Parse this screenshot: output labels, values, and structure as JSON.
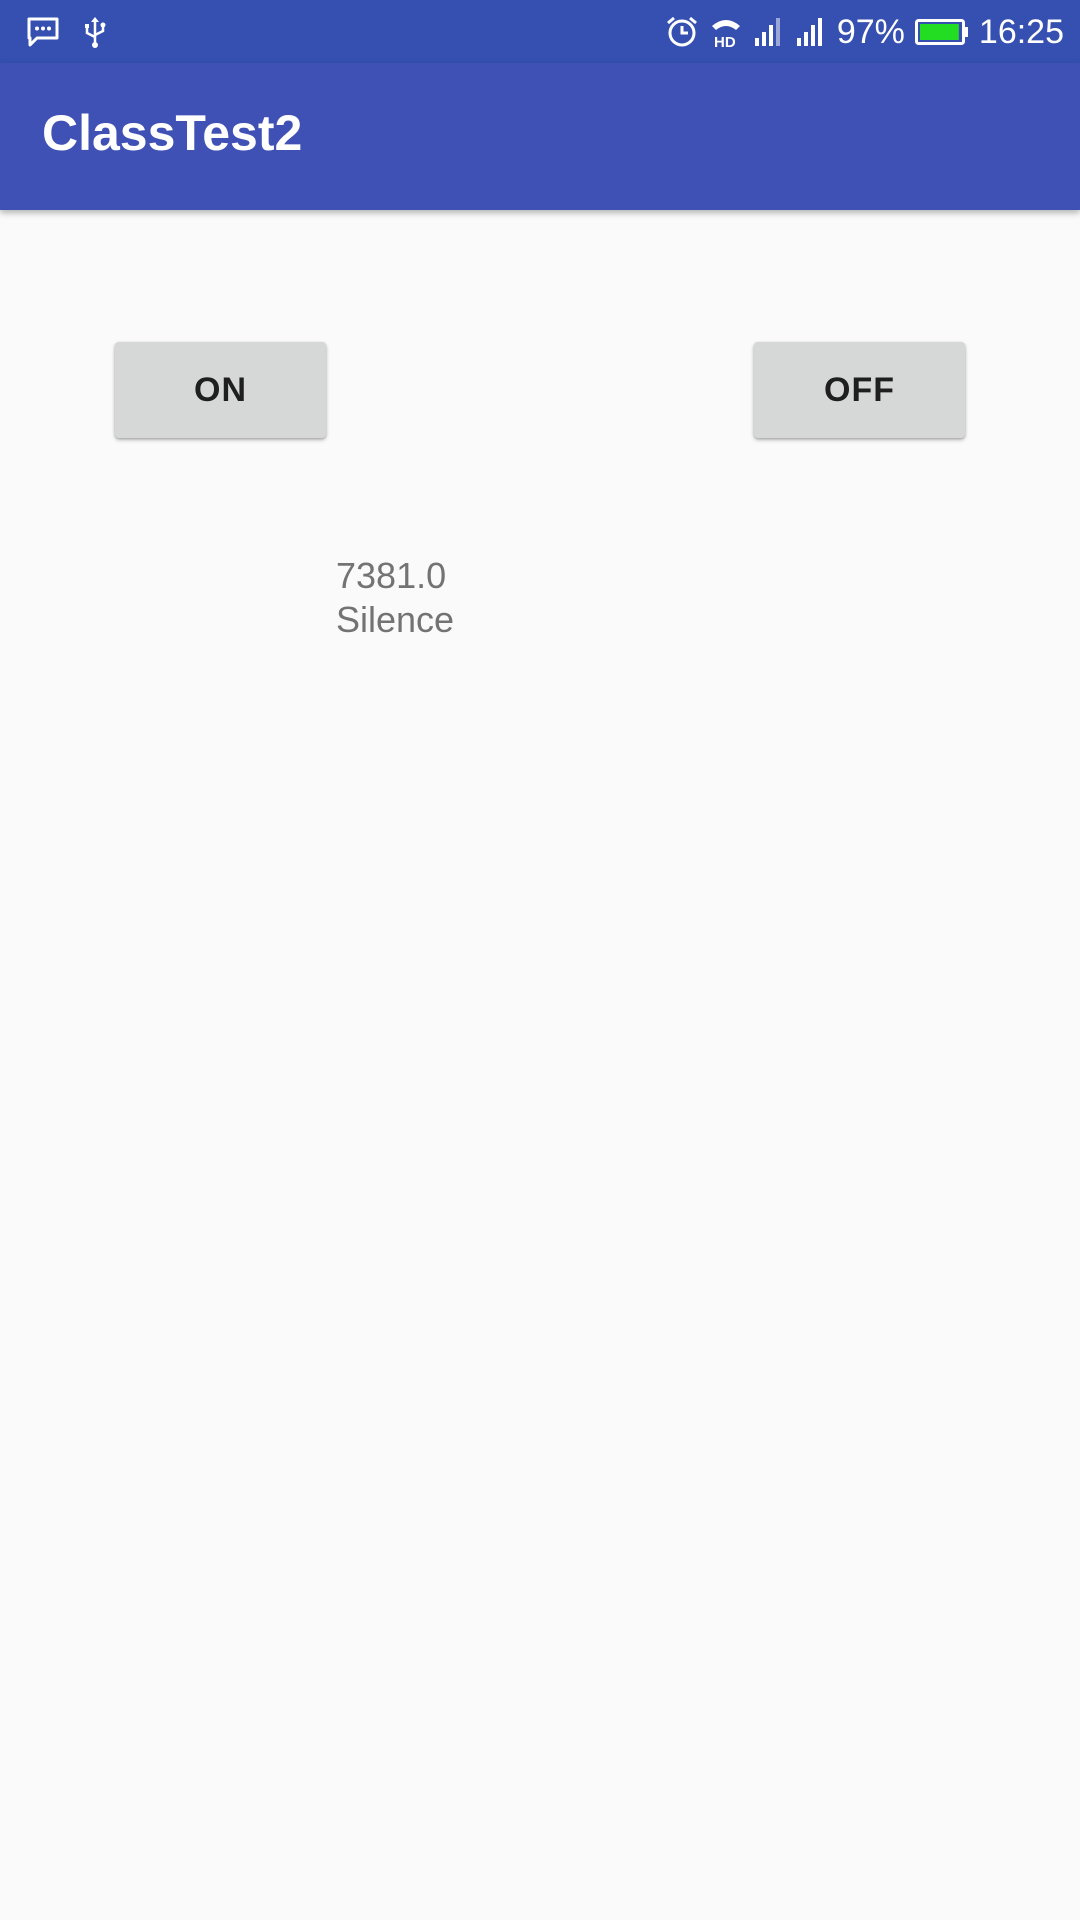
{
  "status_bar": {
    "left_icons": [
      "message-icon",
      "usb-icon"
    ],
    "right_icons": [
      "alarm-icon",
      "hd-voice-icon",
      "signal-icon",
      "signal-icon"
    ],
    "battery_percent": "97%",
    "battery_level": 0.97,
    "battery_color": "#22dd22",
    "time": "16:25"
  },
  "app_bar": {
    "title": "ClassTest2",
    "color": "#3f51b5"
  },
  "controls": {
    "on_label": "ON",
    "off_label": "OFF"
  },
  "readout": {
    "value": "7381.0",
    "status": "Silence"
  }
}
